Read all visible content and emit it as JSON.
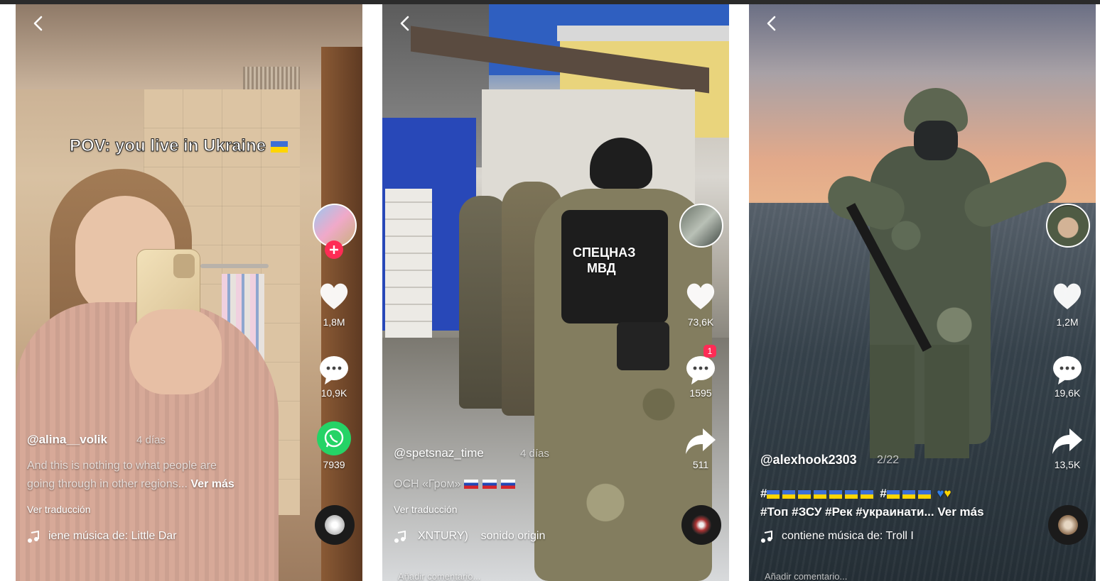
{
  "panels": [
    {
      "caption": "POV: you live in Ukraine",
      "likes": "1,8M",
      "comments": "10,9K",
      "shares": "7939",
      "username": "@alina__volik",
      "date": "4 días",
      "description_line1": "And this is nothing to what people are",
      "description_line2": "going through in other regions...",
      "ver_mas": "Ver más",
      "translate": "Ver traducción",
      "music": "iene música de: Little Dar"
    },
    {
      "vest_text_1": "СПЕЦНАЗ",
      "vest_text_2": "МВД",
      "likes": "73,6K",
      "comments": "1595",
      "comment_badge": "1",
      "shares": "511",
      "username": "@spetsnaz_time",
      "date": "4 días",
      "description": "ОСН «Гром»",
      "translate": "Ver traducción",
      "music_part1": "XNTURY)",
      "music_part2": "sonido origin",
      "comment_placeholder": "Añadir comentario..."
    },
    {
      "likes": "1,2M",
      "comments": "19,6K",
      "shares": "13,5K",
      "username": "@alexhook2303",
      "date": "2/22",
      "hashtags_line1": "#",
      "hashtags_line1b": "#",
      "hashtags_line2": "#Топ #ЗСУ #Рек #украинати...",
      "ver_mas": "Ver más",
      "music": "contiene música de: Troll I",
      "comment_placeholder": "Añadir comentario..."
    }
  ],
  "colors": {
    "whatsapp": "#25d366",
    "follow_plus": "#fe2c55",
    "ukraine_blue": "#3d6fd6",
    "ukraine_yellow": "#ffd500"
  },
  "icons": [
    "back-arrow-icon",
    "heart-icon",
    "comment-icon",
    "share-icon",
    "whatsapp-icon",
    "music-note-icon",
    "music-disc-icon"
  ]
}
